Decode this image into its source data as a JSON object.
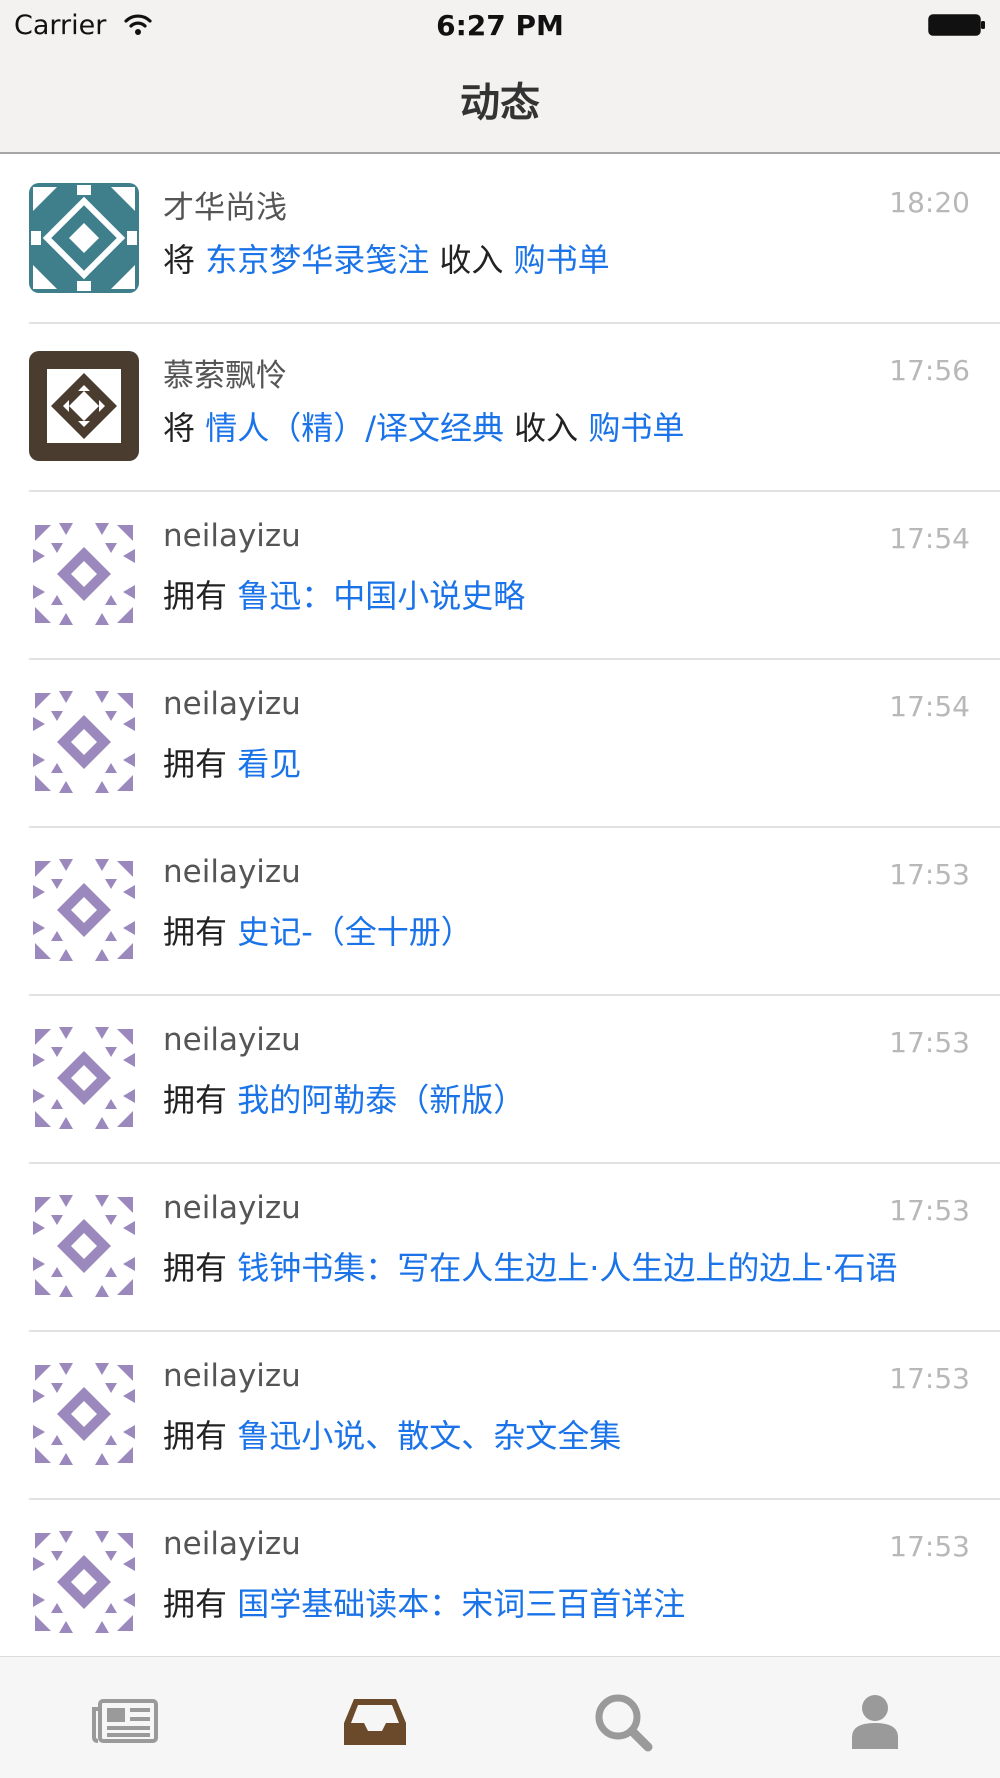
{
  "status_bar": {
    "carrier": "Carrier",
    "time": "6:27 PM"
  },
  "nav": {
    "title": "动态"
  },
  "colors": {
    "link": "#1a73e8",
    "tab_active": "#6b4a2b",
    "tab_inactive": "#9a9a9a",
    "teal_avatar": "#3f7f8c",
    "dark_avatar": "#4a3d2f",
    "purple_avatar": "#9b89bd"
  },
  "feed": [
    {
      "user": "才华尚浅",
      "time": "18:20",
      "verb": "将",
      "book": "东京梦华录笺注",
      "tail": "收入",
      "list": "购书单",
      "avatar": "teal-pattern-avatar"
    },
    {
      "user": "慕萦飘怜",
      "time": "17:56",
      "verb": "将",
      "book": "情人（精）/译文经典",
      "tail": "收入",
      "list": "购书单",
      "avatar": "dark-pattern-avatar"
    },
    {
      "user": "neilayizu",
      "time": "17:54",
      "verb": "拥有",
      "book": "鲁迅：中国小说史略",
      "avatar": "purple-pattern-avatar"
    },
    {
      "user": "neilayizu",
      "time": "17:54",
      "verb": "拥有",
      "book": "看见",
      "avatar": "purple-pattern-avatar"
    },
    {
      "user": "neilayizu",
      "time": "17:53",
      "verb": "拥有",
      "book": "史记-（全十册）",
      "avatar": "purple-pattern-avatar"
    },
    {
      "user": "neilayizu",
      "time": "17:53",
      "verb": "拥有",
      "book": "我的阿勒泰（新版）",
      "avatar": "purple-pattern-avatar"
    },
    {
      "user": "neilayizu",
      "time": "17:53",
      "verb": "拥有",
      "book": "钱钟书集：写在人生边上·人生边上的边上·石语",
      "avatar": "purple-pattern-avatar"
    },
    {
      "user": "neilayizu",
      "time": "17:53",
      "verb": "拥有",
      "book": "鲁迅小说、散文、杂文全集",
      "avatar": "purple-pattern-avatar"
    },
    {
      "user": "neilayizu",
      "time": "17:53",
      "verb": "拥有",
      "book": "国学基础读本：宋词三百首详注",
      "avatar": "purple-pattern-avatar"
    }
  ],
  "tabbar": {
    "tabs": [
      {
        "icon": "newspaper-icon",
        "active": false
      },
      {
        "icon": "inbox-tray-icon",
        "active": true
      },
      {
        "icon": "search-icon",
        "active": false
      },
      {
        "icon": "person-icon",
        "active": false
      }
    ]
  }
}
